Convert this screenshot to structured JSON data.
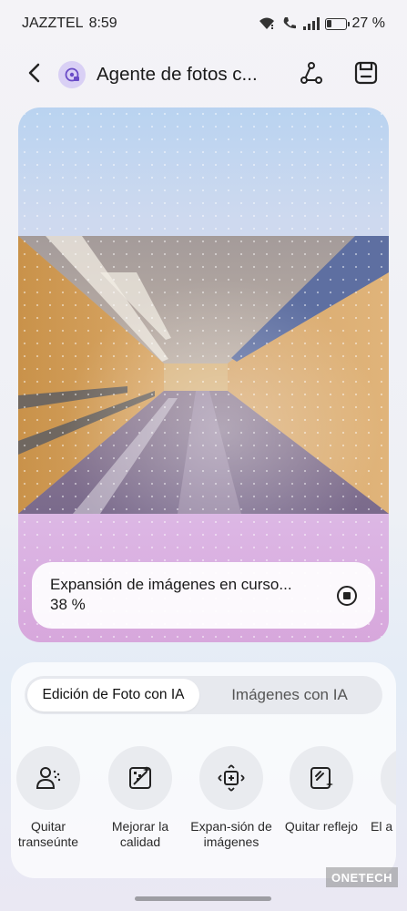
{
  "status_bar": {
    "carrier": "JAZZTEL",
    "time": "8:59",
    "battery_percent": "27 %",
    "battery_level": 0.27,
    "icons": [
      "wifi-icon",
      "wifi-calling-icon",
      "signal-icon",
      "battery-icon"
    ]
  },
  "app_bar": {
    "title": "Agente de fotos c...",
    "icons": [
      "back-arrow-icon",
      "photo-agent-icon",
      "share-icon",
      "save-icon"
    ]
  },
  "preview": {
    "progress_text": "Expansión de imágenes en curso...",
    "progress_percent": "38 %",
    "progress_value": 0.38,
    "stop_icon": "stop-icon"
  },
  "tools": {
    "tabs": [
      {
        "label": "Edición de Foto con IA",
        "active": true
      },
      {
        "label": "Imágenes con IA",
        "active": false
      }
    ],
    "items": [
      {
        "label": "Quitar transeúnte",
        "icon": "remove-person-icon"
      },
      {
        "label": "Mejorar la calidad",
        "icon": "enhance-quality-icon"
      },
      {
        "label": "Expan-sión de imágenes",
        "icon": "expand-image-icon"
      },
      {
        "label": "Quitar reflejo",
        "icon": "remove-reflection-icon"
      },
      {
        "label": "El a",
        "icon": "partial-tool-icon"
      }
    ]
  },
  "watermark": "ONETECH",
  "colors": {
    "accent_purple": "#d9d0f5",
    "text": "#1a1a1a"
  }
}
